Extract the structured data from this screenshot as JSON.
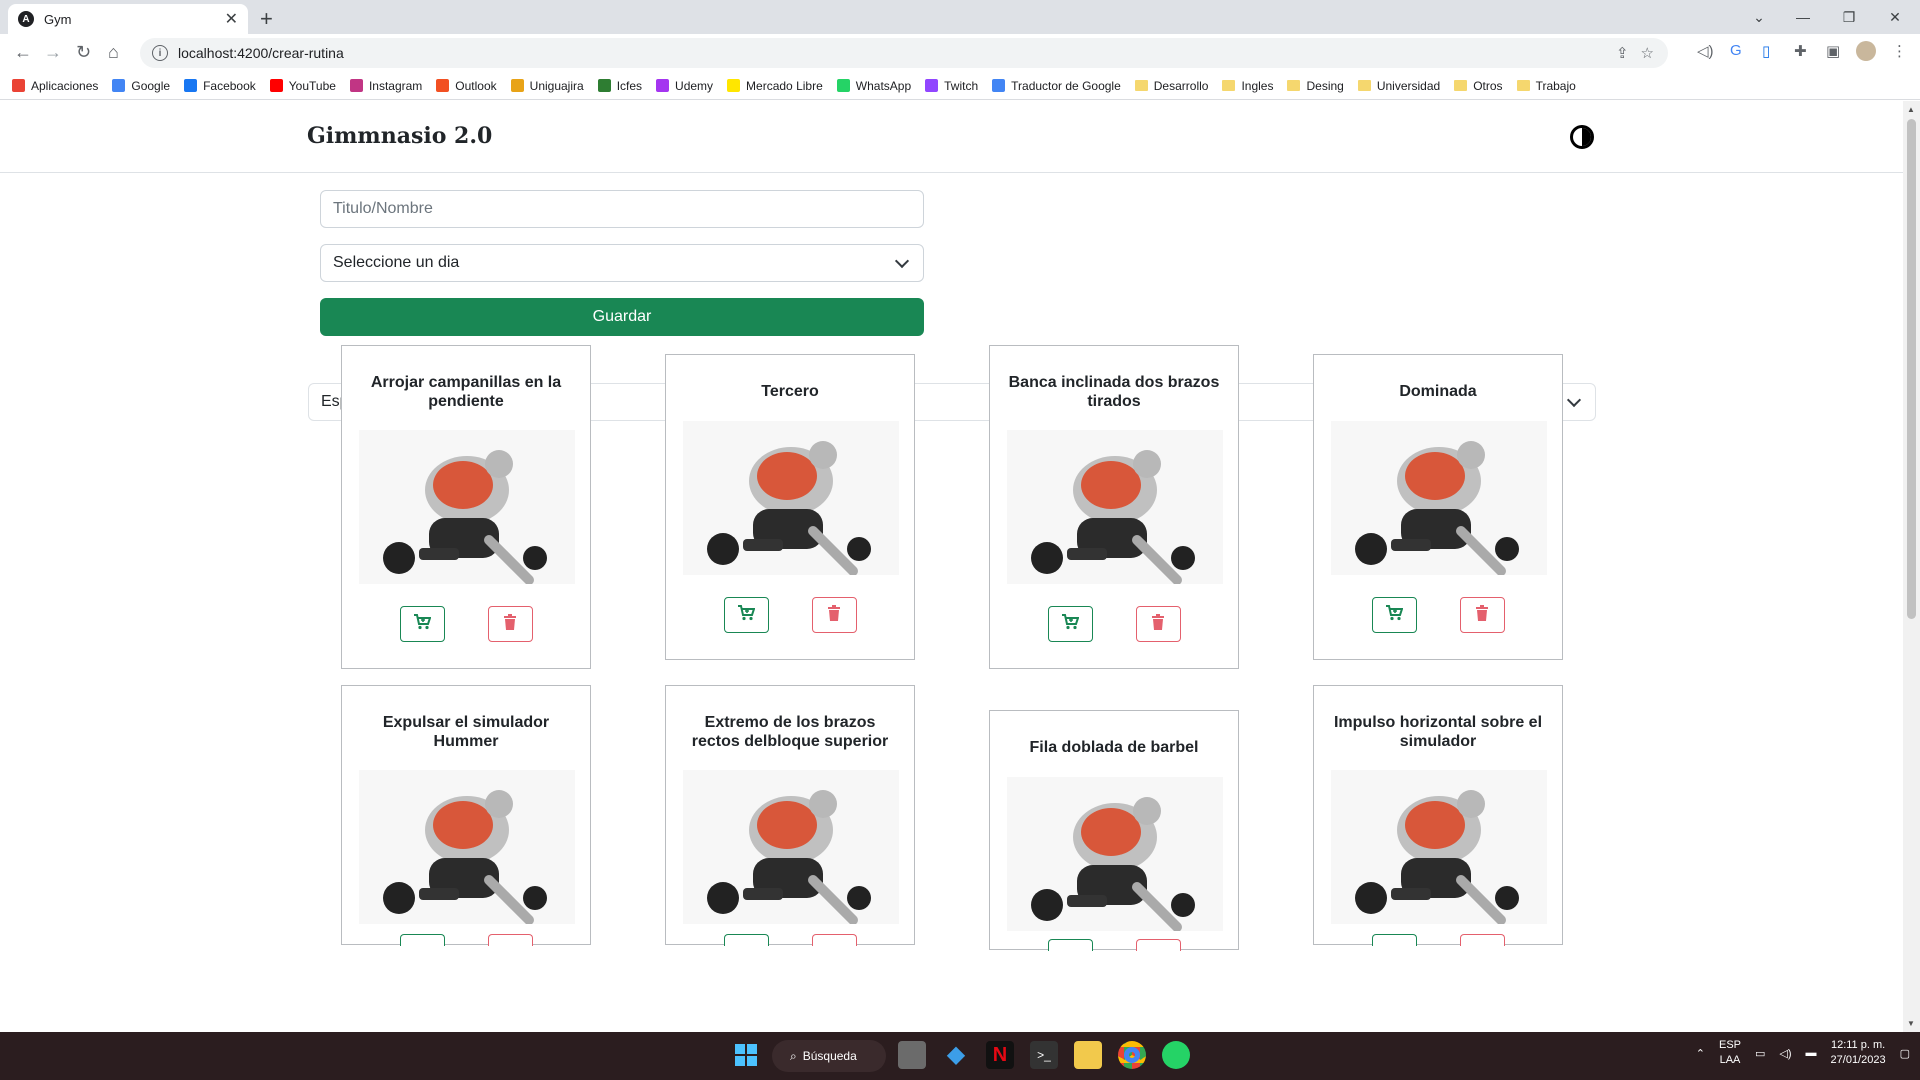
{
  "browser": {
    "tab_title": "Gym",
    "url": "localhost:4200/crear-rutina",
    "bookmarks": [
      {
        "label": "Aplicaciones",
        "color": "#ea4335"
      },
      {
        "label": "Google",
        "color": "#4285f4"
      },
      {
        "label": "Facebook",
        "color": "#1877f2"
      },
      {
        "label": "YouTube",
        "color": "#ff0000"
      },
      {
        "label": "Instagram",
        "color": "#c13584"
      },
      {
        "label": "Outlook",
        "color": "#f25022"
      },
      {
        "label": "Uniguajira",
        "color": "#e8a317"
      },
      {
        "label": "Icfes",
        "color": "#2e7d32"
      },
      {
        "label": "Udemy",
        "color": "#a435f0"
      },
      {
        "label": "Mercado Libre",
        "color": "#ffe600"
      },
      {
        "label": "WhatsApp",
        "color": "#25d366"
      },
      {
        "label": "Twitch",
        "color": "#9146ff"
      },
      {
        "label": "Traductor de Google",
        "color": "#4285f4"
      }
    ],
    "folders": [
      "Desarrollo",
      "Ingles",
      "Desing",
      "Universidad",
      "Otros",
      "Trabajo"
    ]
  },
  "header": {
    "brand": "Gimmnasio 2.0"
  },
  "form": {
    "title_placeholder": "Titulo/Nombre",
    "day_select": "Seleccione un dia",
    "save_label": "Guardar"
  },
  "category_select": "Espalda",
  "cards": [
    {
      "title": "Arrojar campanillas en la pendiente"
    },
    {
      "title": "Tercero"
    },
    {
      "title": "Banca inclinada dos brazos tirados"
    },
    {
      "title": "Dominada"
    },
    {
      "title": "Expulsar el simulador Hummer"
    },
    {
      "title": "Extremo de los brazos rectos delbloque superior"
    },
    {
      "title": "Fila doblada de barbel"
    },
    {
      "title": "Impulso horizontal sobre el simulador"
    }
  ],
  "taskbar": {
    "search_label": "Búsqueda",
    "lang_top": "ESP",
    "lang_bottom": "LAA",
    "time": "12:11 p. m.",
    "date": "27/01/2023"
  },
  "colors": {
    "primary_green": "#198754",
    "danger": "#dc3545"
  }
}
